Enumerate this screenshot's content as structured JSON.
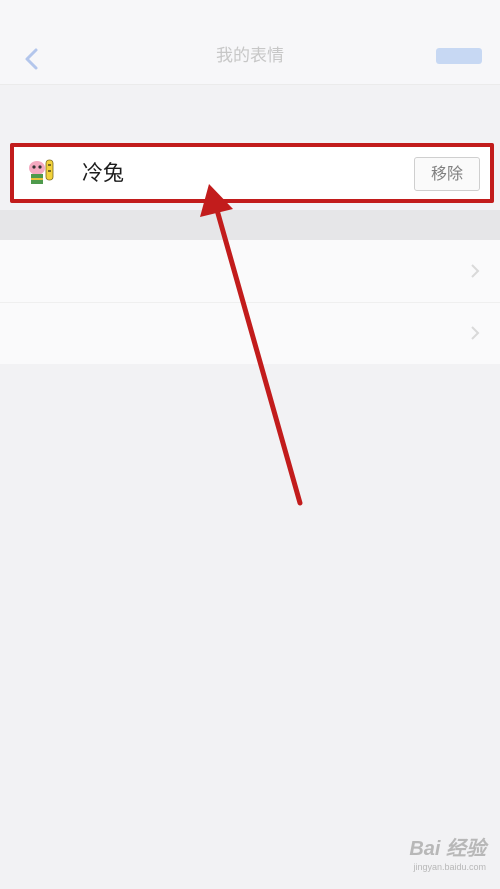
{
  "status_bar": {
    "carrier": "",
    "time": "",
    "battery": ""
  },
  "nav": {
    "title": "我的表情",
    "back_icon": "chevron-left-icon",
    "accent_color": "#c7d8f3"
  },
  "section": {
    "header": ""
  },
  "emoji_pack": {
    "name": "冷兔",
    "remove_label": "移除",
    "thumb_icon": "emoji-sticker-icon"
  },
  "menu": {
    "items": [
      {
        "label": "",
        "icon": "chevron-right-icon"
      },
      {
        "label": "",
        "icon": "chevron-right-icon"
      }
    ]
  },
  "annotation": {
    "color": "#c21c1c"
  },
  "watermark": {
    "brand": "Bai 经验",
    "url": "jingyan.baidu.com"
  }
}
